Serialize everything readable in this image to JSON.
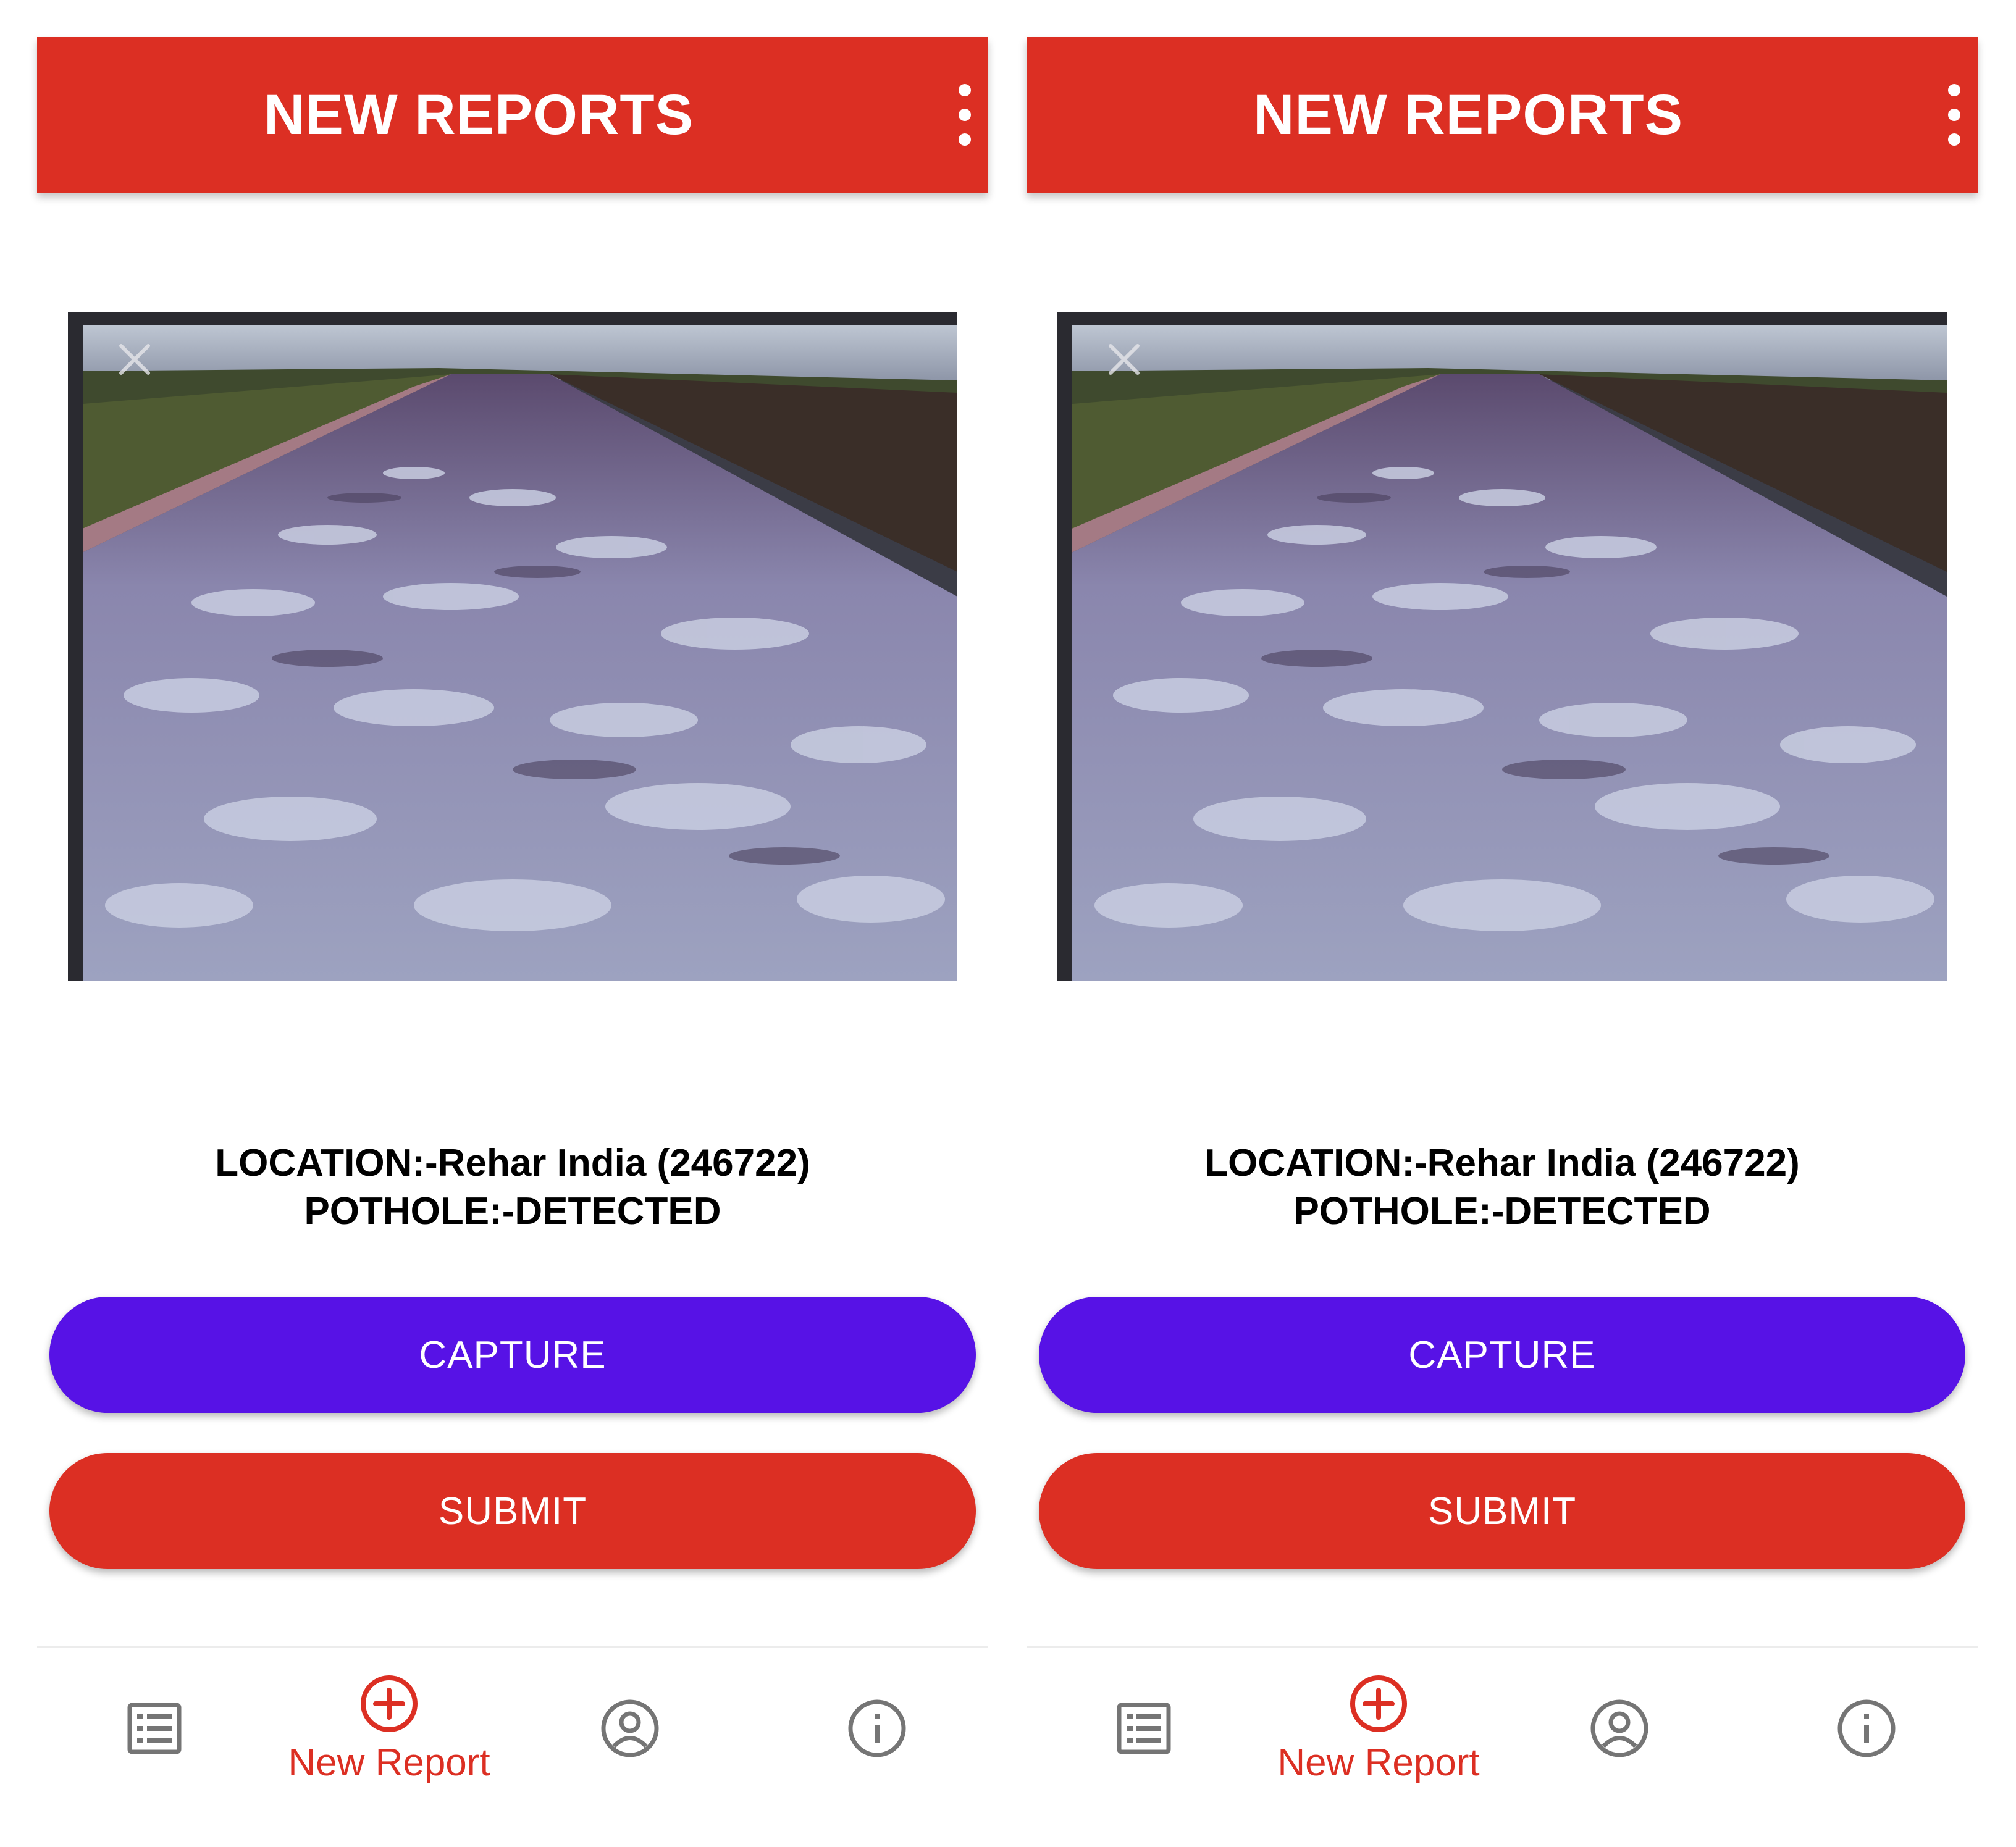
{
  "colors": {
    "app_bar": "#DC2F23",
    "capture_button": "#5712E6",
    "submit_button": "#DC2F23",
    "nav_active": "#DC2F23",
    "nav_inactive": "#757575"
  },
  "screens": [
    {
      "header": {
        "title": "NEW REPORTS",
        "menu_icon": "more-vert-icon"
      },
      "photo": {
        "close_icon": "close-icon"
      },
      "info": {
        "location": "LOCATION:-Rehar India (246722)",
        "pothole": "POTHOLE:-DETECTED"
      },
      "buttons": {
        "capture": "CAPTURE",
        "submit": "SUBMIT"
      },
      "nav": {
        "items": [
          {
            "icon": "list-icon",
            "label": ""
          },
          {
            "icon": "add-circle-icon",
            "label": "New Report",
            "active": true
          },
          {
            "icon": "account-circle-icon",
            "label": ""
          },
          {
            "icon": "info-icon",
            "label": ""
          }
        ]
      }
    },
    {
      "header": {
        "title": "NEW REPORTS",
        "menu_icon": "more-vert-icon"
      },
      "photo": {
        "close_icon": "close-icon"
      },
      "info": {
        "location": "LOCATION:-Rehar India (246722)",
        "pothole": "POTHOLE:-DETECTED"
      },
      "buttons": {
        "capture": "CAPTURE",
        "submit": "SUBMIT"
      },
      "nav": {
        "items": [
          {
            "icon": "list-icon",
            "label": ""
          },
          {
            "icon": "add-circle-icon",
            "label": "New Report",
            "active": true
          },
          {
            "icon": "account-circle-icon",
            "label": ""
          },
          {
            "icon": "info-icon",
            "label": ""
          }
        ]
      }
    }
  ]
}
